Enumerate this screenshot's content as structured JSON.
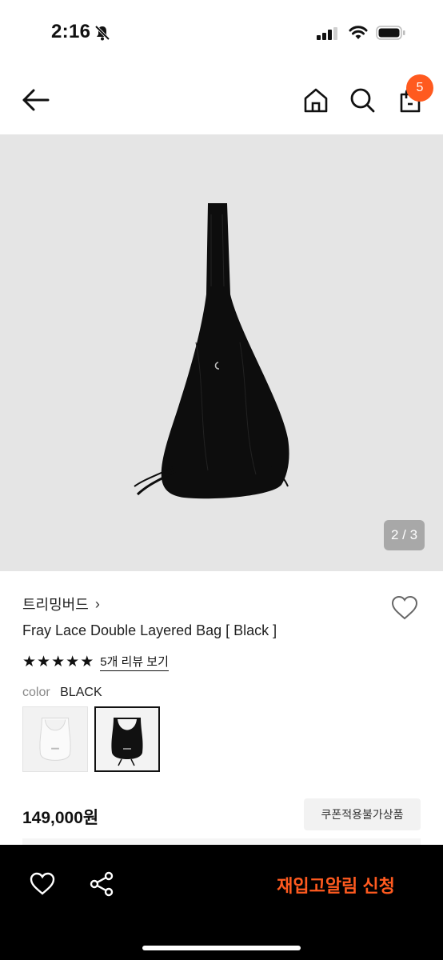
{
  "status": {
    "time": "2:16"
  },
  "header": {
    "cart_count": "5"
  },
  "image": {
    "counter": "2 / 3"
  },
  "product": {
    "brand": "트리밍버드",
    "brand_chevron": "›",
    "title": "Fray Lace Double Layered Bag [ Black ]",
    "rating_stars": 5,
    "review_link": "5개 리뷰 보기",
    "color_label": "color",
    "color_value": "BLACK",
    "price": "149,000원",
    "coupon_badge": "쿠폰적용불가상품"
  },
  "bottom": {
    "restock_label": "재입고알림 신청"
  },
  "colors": {
    "accent": "#ff5a1f",
    "bar": "#000000",
    "image_bg": "#e5e5e5"
  },
  "icons": {
    "back": "arrow-left-icon",
    "home": "home-icon",
    "search": "search-icon",
    "cart": "shopping-bag-icon",
    "wish": "heart-icon",
    "share": "share-icon"
  }
}
